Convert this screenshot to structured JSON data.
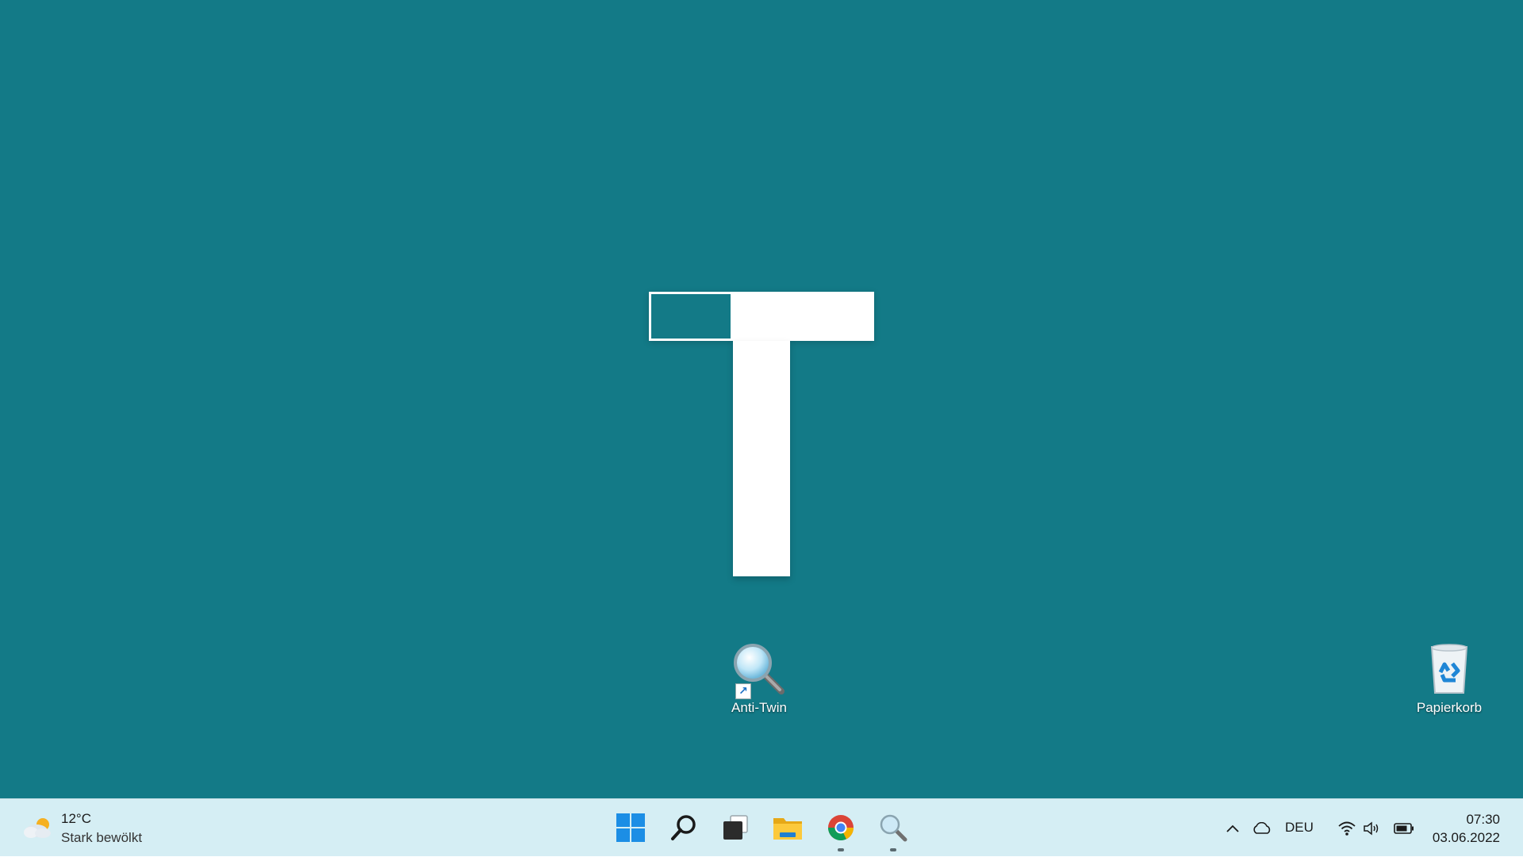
{
  "desktop": {
    "background_color": "#137a87",
    "icons": [
      {
        "label": "Anti-Twin",
        "icon": "magnifier-icon",
        "shortcut": true
      },
      {
        "label": "Papierkorb",
        "icon": "recycle-bin-icon",
        "shortcut": false
      }
    ]
  },
  "taskbar": {
    "background_color": "#d5eef4",
    "weather": {
      "temperature": "12°C",
      "description": "Stark bewölkt",
      "icon": "partly-cloudy-icon"
    },
    "apps": [
      {
        "name": "start",
        "icon": "windows-start-icon",
        "running": false
      },
      {
        "name": "search",
        "icon": "search-icon",
        "running": false
      },
      {
        "name": "task-view",
        "icon": "task-view-icon",
        "running": false
      },
      {
        "name": "file-explorer",
        "icon": "folder-icon",
        "running": false
      },
      {
        "name": "chrome",
        "icon": "chrome-icon",
        "running": true
      },
      {
        "name": "anti-twin",
        "icon": "magnifier-icon",
        "running": true
      }
    ],
    "tray": {
      "language": "DEU",
      "icons": [
        "chevron-up-icon",
        "onedrive-cloud-icon",
        "wifi-icon",
        "speaker-icon",
        "battery-icon"
      ]
    },
    "clock": {
      "time": "07:30",
      "date": "03.06.2022"
    }
  }
}
